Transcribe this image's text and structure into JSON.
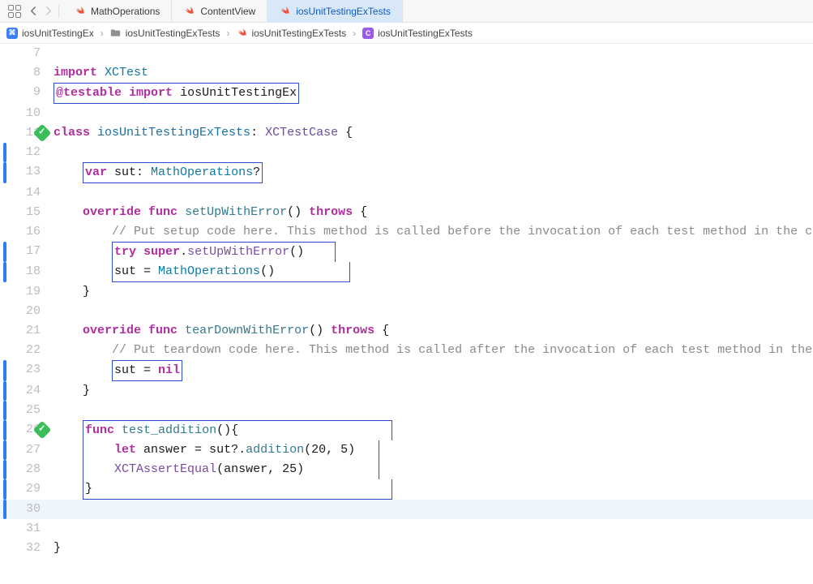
{
  "tabs": {
    "t0": "MathOperations",
    "t1": "ContentView",
    "t2": "iosUnitTestingExTests"
  },
  "breadcrumb": {
    "b0": "iosUnitTestingEx",
    "b1": "iosUnitTestingExTests",
    "b2": "iosUnitTestingExTests",
    "b3": "iosUnitTestingExTests"
  },
  "lines": {
    "n7": "7",
    "n8": "8",
    "n9": "9",
    "n10": "10",
    "n11": "11",
    "n12": "12",
    "n13": "13",
    "n14": "14",
    "n15": "15",
    "n16": "16",
    "n17": "17",
    "n18": "18",
    "n19": "19",
    "n20": "20",
    "n21": "21",
    "n22": "22",
    "n23": "23",
    "n24": "24",
    "n25": "25",
    "n26": "26",
    "n27": "27",
    "n28": "28",
    "n29": "29",
    "n30": "30",
    "n31": "31",
    "n32": "32"
  },
  "code": {
    "l8_import": "import",
    "l8_xctest": "XCTest",
    "l9_attr": "@testable",
    "l9_import": "import",
    "l9_mod": "iosUnitTestingEx",
    "l11_class": "class",
    "l11_name": "iosUnitTestingExTests",
    "l11_colon": ": ",
    "l11_super": "XCTestCase",
    "l11_brace": " {",
    "l13_var": "var",
    "l13_sut": " sut: ",
    "l13_type": "MathOperations",
    "l13_q": "?",
    "l15_override": "override",
    "l15_func": "func",
    "l15_name": "setUpWithError",
    "l15_paren": "() ",
    "l15_throws": "throws",
    "l15_brace": " {",
    "l16_comment": "// Put setup code here. This method is called before the invocation of each test method in the class.",
    "l17_try": "try",
    "l17_super": "super",
    "l17_dot": ".",
    "l17_call": "setUpWithError",
    "l17_paren": "()",
    "l18_sut": "sut = ",
    "l18_type": "MathOperations",
    "l18_paren": "()",
    "l19_brace": "}",
    "l21_override": "override",
    "l21_func": "func",
    "l21_name": "tearDownWithError",
    "l21_paren": "() ",
    "l21_throws": "throws",
    "l21_brace": " {",
    "l22_comment": "// Put teardown code here. This method is called after the invocation of each test method in the class.",
    "l23_sut": "sut = ",
    "l23_nil": "nil",
    "l24_brace": "}",
    "l26_func": "func",
    "l26_name": "test_addition",
    "l26_paren": "(){",
    "l27_let": "let",
    "l27_ans": " answer = sut?.",
    "l27_add": "addition",
    "l27_args": "(",
    "l27_n1": "20",
    "l27_c": ", ",
    "l27_n2": "5",
    "l27_close": ")",
    "l28_assert": "XCTAssertEqual",
    "l28_open": "(answer, ",
    "l28_n": "25",
    "l28_close": ")",
    "l29_brace": "}",
    "l32_brace": "}"
  }
}
